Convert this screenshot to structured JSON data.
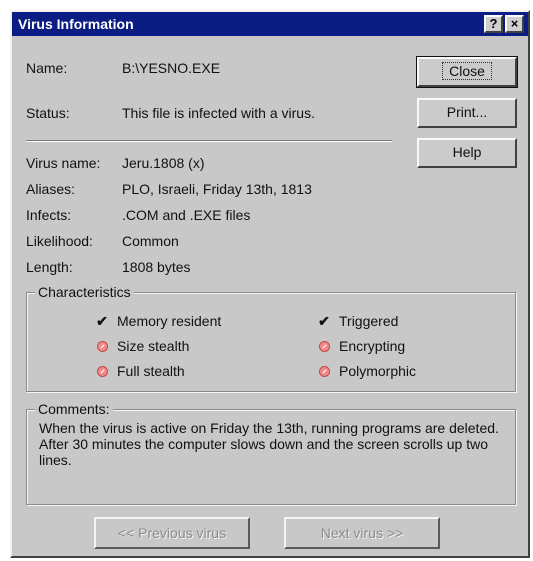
{
  "window": {
    "title": "Virus Information",
    "help_button": "?",
    "close_button": "×"
  },
  "fields": {
    "name_label": "Name:",
    "name_value": "B:\\YESNO.EXE",
    "status_label": "Status:",
    "status_value": "This file is infected with a virus."
  },
  "info": {
    "virus_name_label": "Virus name:",
    "virus_name_value": "Jeru.1808 (x)",
    "aliases_label": "Aliases:",
    "aliases_value": "PLO, Israeli, Friday 13th, 1813",
    "infects_label": "Infects:",
    "infects_value": ".COM and .EXE files",
    "likelihood_label": "Likelihood:",
    "likelihood_value": "Common",
    "length_label": "Length:",
    "length_value": "1808 bytes"
  },
  "buttons": {
    "close": "Close",
    "print": "Print...",
    "help": "Help"
  },
  "characteristics": {
    "legend": "Characteristics",
    "items": [
      {
        "label": "Memory resident",
        "state": "checked"
      },
      {
        "label": "Triggered",
        "state": "checked"
      },
      {
        "label": "Size stealth",
        "state": "unchecked"
      },
      {
        "label": "Encrypting",
        "state": "unchecked"
      },
      {
        "label": "Full stealth",
        "state": "unchecked"
      },
      {
        "label": "Polymorphic",
        "state": "unchecked"
      }
    ]
  },
  "comments": {
    "legend": "Comments:",
    "text": "When the virus is active on Friday the 13th, running programs are deleted. After 30 minutes the computer slows down and the screen scrolls up two lines."
  },
  "navigation": {
    "previous": "<< Previous virus",
    "next": "Next virus >>"
  },
  "colors": {
    "titlebar": "#0b1d82",
    "face": "#c8c8c8",
    "check_mark": "#000000",
    "no_mark": "#f08a8a"
  }
}
